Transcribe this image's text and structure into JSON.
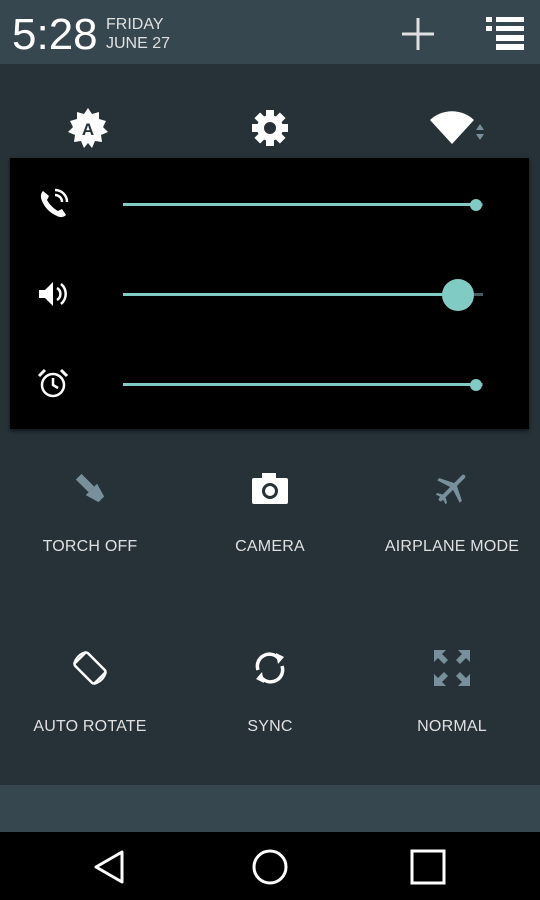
{
  "header": {
    "time": "5:28",
    "day": "FRIDAY",
    "date": "JUNE 27",
    "add_icon": "plus-icon",
    "list_icon": "notification-list-icon"
  },
  "quick_icons": [
    {
      "name": "auto-brightness-icon"
    },
    {
      "name": "settings-gear-icon"
    },
    {
      "name": "wifi-signal-icon"
    }
  ],
  "volume": {
    "ringtone": {
      "icon": "phone-ringing-icon",
      "level": 0.98
    },
    "media": {
      "icon": "speaker-volume-icon",
      "level": 0.93
    },
    "alarm": {
      "icon": "alarm-clock-icon",
      "level": 0.98
    },
    "accent": "#80cbc4"
  },
  "tiles": [
    {
      "label": "TORCH OFF",
      "icon": "flashlight-icon"
    },
    {
      "label": "CAMERA",
      "icon": "camera-icon"
    },
    {
      "label": "AIRPLANE MODE",
      "icon": "airplane-icon"
    },
    {
      "label": "AUTO ROTATE",
      "icon": "rotate-icon"
    },
    {
      "label": "SYNC",
      "icon": "sync-icon"
    },
    {
      "label": "NORMAL",
      "icon": "expand-arrows-icon"
    }
  ],
  "nav": {
    "back_icon": "back-triangle-icon",
    "home_icon": "home-circle-icon",
    "recents_icon": "recents-square-icon"
  }
}
